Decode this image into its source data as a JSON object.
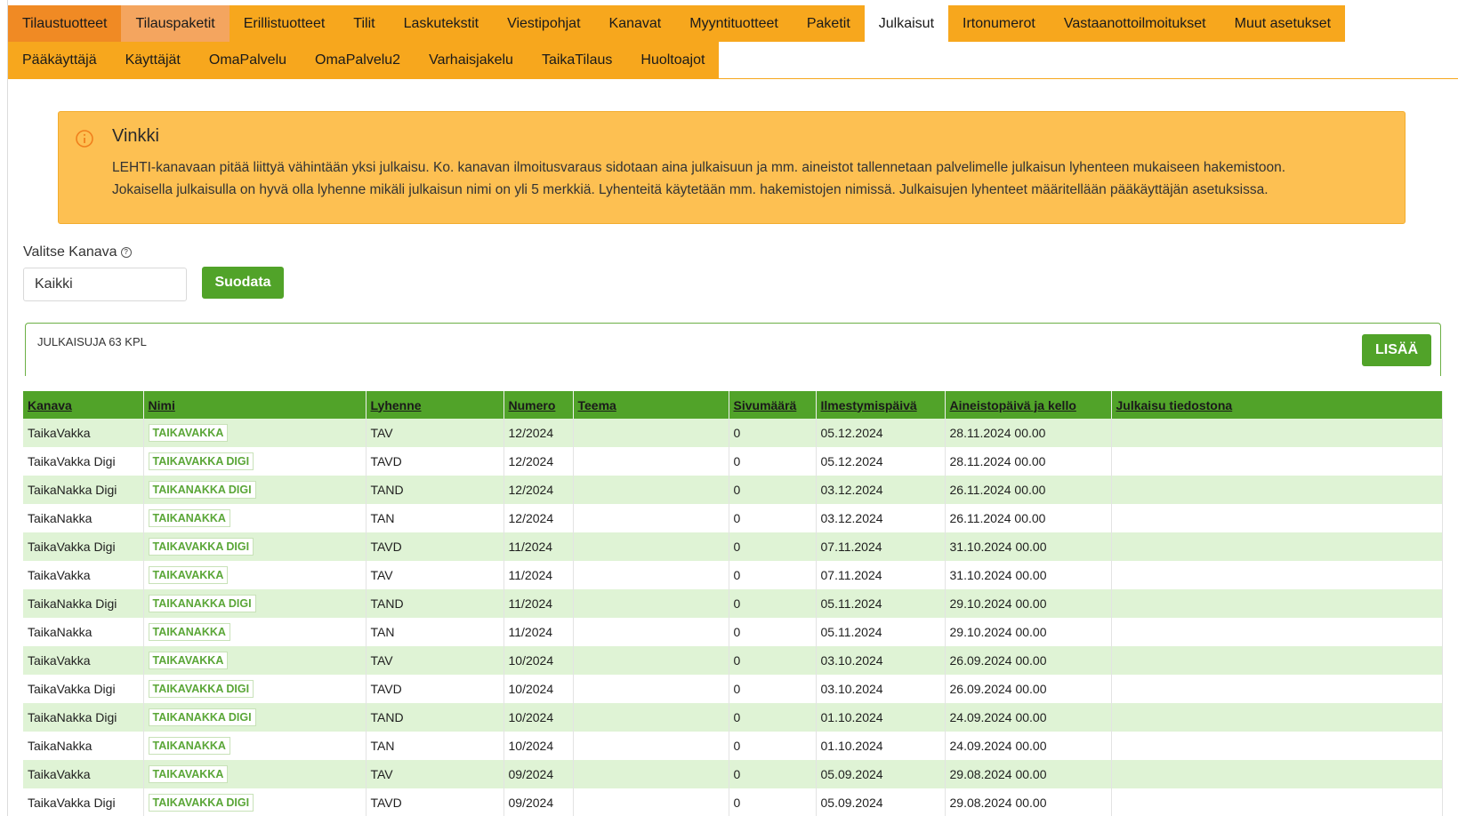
{
  "tabs": {
    "row1": [
      "Tilaustuotteet",
      "Tilauspaketit",
      "Erillistuotteet",
      "Tilit",
      "Laskutekstit",
      "Viestipohjat",
      "Kanavat",
      "Myyntituotteet",
      "Paketit",
      "Julkaisut",
      "Irtonumerot",
      "Vastaanottoilmoitukset",
      "Muut asetukset"
    ],
    "row2": [
      "Pääkäyttäjä",
      "Käyttäjät",
      "OmaPalvelu",
      "OmaPalvelu2",
      "Varhaisjakelu",
      "TaikaTilaus",
      "Huoltoajot"
    ],
    "active": "Julkaisut"
  },
  "tip": {
    "title": "Vinkki",
    "line1": "LEHTI-kanavaan pitää liittyä vähintään yksi julkaisu. Ko. kanavan ilmoitusvaraus sidotaan aina julkaisuun ja mm. aineistot tallennetaan palvelimelle julkaisun lyhenteen mukaiseen hakemistoon.",
    "line2": "Jokaisella julkaisulla on hyvä olla lyhenne mikäli julkaisun nimi on yli 5 merkkiä. Lyhenteitä käytetään mm. hakemistojen nimissä. Julkaisujen lyhenteet määritellään pääkäyttäjän asetuksissa.",
    "icon": "info-circle-icon",
    "color": "#fdc052"
  },
  "filter": {
    "label": "Valitse Kanava",
    "selected": "Kaikki",
    "button": "Suodata"
  },
  "panel": {
    "count_label": "JULKAISUJA 63 KPL",
    "add_button": "LISÄÄ"
  },
  "table": {
    "columns": [
      "Kanava",
      "Nimi",
      "Lyhenne",
      "Numero",
      "Teema",
      "Sivumäärä",
      "Ilmestymispäivä",
      "Aineistopäivä ja kello",
      "Julkaisu tiedostona"
    ],
    "rows": [
      [
        "TaikaVakka",
        "TAIKAVAKKA",
        "TAV",
        "12/2024",
        "",
        "0",
        "05.12.2024",
        "28.11.2024 00.00",
        ""
      ],
      [
        "TaikaVakka Digi",
        "TAIKAVAKKA DIGI",
        "TAVD",
        "12/2024",
        "",
        "0",
        "05.12.2024",
        "28.11.2024 00.00",
        ""
      ],
      [
        "TaikaNakka Digi",
        "TAIKANAKKA DIGI",
        "TAND",
        "12/2024",
        "",
        "0",
        "03.12.2024",
        "26.11.2024 00.00",
        ""
      ],
      [
        "TaikaNakka",
        "TAIKANAKKA",
        "TAN",
        "12/2024",
        "",
        "0",
        "03.12.2024",
        "26.11.2024 00.00",
        ""
      ],
      [
        "TaikaVakka Digi",
        "TAIKAVAKKA DIGI",
        "TAVD",
        "11/2024",
        "",
        "0",
        "07.11.2024",
        "31.10.2024 00.00",
        ""
      ],
      [
        "TaikaVakka",
        "TAIKAVAKKA",
        "TAV",
        "11/2024",
        "",
        "0",
        "07.11.2024",
        "31.10.2024 00.00",
        ""
      ],
      [
        "TaikaNakka Digi",
        "TAIKANAKKA DIGI",
        "TAND",
        "11/2024",
        "",
        "0",
        "05.11.2024",
        "29.10.2024 00.00",
        ""
      ],
      [
        "TaikaNakka",
        "TAIKANAKKA",
        "TAN",
        "11/2024",
        "",
        "0",
        "05.11.2024",
        "29.10.2024 00.00",
        ""
      ],
      [
        "TaikaVakka",
        "TAIKAVAKKA",
        "TAV",
        "10/2024",
        "",
        "0",
        "03.10.2024",
        "26.09.2024 00.00",
        ""
      ],
      [
        "TaikaVakka Digi",
        "TAIKAVAKKA DIGI",
        "TAVD",
        "10/2024",
        "",
        "0",
        "03.10.2024",
        "26.09.2024 00.00",
        ""
      ],
      [
        "TaikaNakka Digi",
        "TAIKANAKKA DIGI",
        "TAND",
        "10/2024",
        "",
        "0",
        "01.10.2024",
        "24.09.2024 00.00",
        ""
      ],
      [
        "TaikaNakka",
        "TAIKANAKKA",
        "TAN",
        "10/2024",
        "",
        "0",
        "01.10.2024",
        "24.09.2024 00.00",
        ""
      ],
      [
        "TaikaVakka",
        "TAIKAVAKKA",
        "TAV",
        "09/2024",
        "",
        "0",
        "05.09.2024",
        "29.08.2024 00.00",
        ""
      ],
      [
        "TaikaVakka Digi",
        "TAIKAVAKKA DIGI",
        "TAVD",
        "09/2024",
        "",
        "0",
        "05.09.2024",
        "29.08.2024 00.00",
        ""
      ]
    ]
  },
  "colors": {
    "tab_orange": "#f7a71d",
    "tab_first": "#f08a24",
    "green": "#51a329",
    "row_green": "#dff3d5"
  }
}
